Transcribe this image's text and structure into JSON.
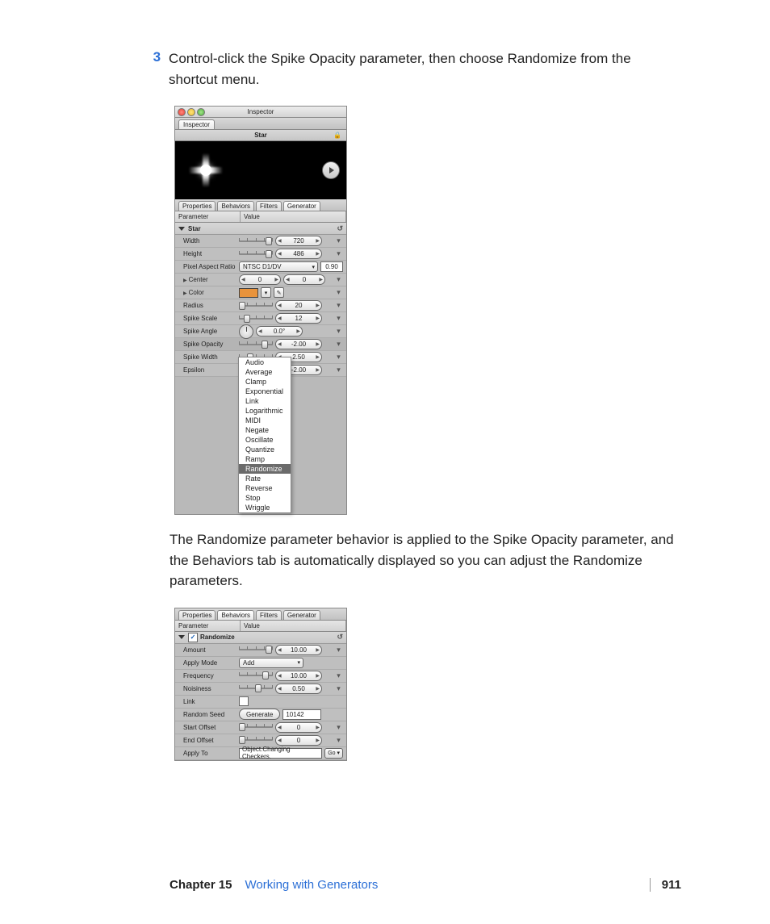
{
  "step": {
    "number": "3",
    "text": "Control-click the Spike Opacity parameter, then choose Randomize from the shortcut menu."
  },
  "paragraph": "The Randomize parameter behavior is applied to the Spike Opacity parameter, and the Behaviors tab is automatically displayed so you can adjust the Randomize parameters.",
  "footer": {
    "chapter": "Chapter 15",
    "title": "Working with Generators",
    "page": "911"
  },
  "panel1": {
    "windowTitle": "Inspector",
    "topTab": "Inspector",
    "objectName": "Star",
    "subtabs": [
      "Properties",
      "Behaviors",
      "Filters",
      "Generator"
    ],
    "activeSubtab": "Generator",
    "columns": {
      "param": "Parameter",
      "value": "Value"
    },
    "groupName": "Star",
    "rows": {
      "width": {
        "label": "Width",
        "value": "720"
      },
      "height": {
        "label": "Height",
        "value": "486"
      },
      "par": {
        "label": "Pixel Aspect Ratio",
        "value": "NTSC D1/DV",
        "ratio": "0.90"
      },
      "center": {
        "label": "Center",
        "x": "0",
        "y": "0"
      },
      "color": {
        "label": "Color"
      },
      "radius": {
        "label": "Radius",
        "value": "20"
      },
      "spikeScale": {
        "label": "Spike Scale",
        "value": "12"
      },
      "spikeAngle": {
        "label": "Spike Angle",
        "value": "0.0°"
      },
      "spikeOpacity": {
        "label": "Spike Opacity",
        "value": "-2.00"
      },
      "spikeWidth": {
        "label": "Spike Width",
        "value": "2.50"
      },
      "epsilon": {
        "label": "Epsilon",
        "value": "-2.00"
      }
    },
    "contextMenu": [
      "Audio",
      "Average",
      "Clamp",
      "Exponential",
      "Link",
      "Logarithmic",
      "MIDI",
      "Negate",
      "Oscillate",
      "Quantize",
      "Ramp",
      "Randomize",
      "Rate",
      "Reverse",
      "Stop",
      "Wriggle"
    ],
    "contextSelected": "Randomize"
  },
  "panel2": {
    "subtabs": [
      "Properties",
      "Behaviors",
      "Filters",
      "Generator"
    ],
    "activeSubtab": "Behaviors",
    "columns": {
      "param": "Parameter",
      "value": "Value"
    },
    "groupName": "Randomize",
    "rows": {
      "amount": {
        "label": "Amount",
        "value": "10.00"
      },
      "applyMode": {
        "label": "Apply Mode",
        "value": "Add"
      },
      "frequency": {
        "label": "Frequency",
        "value": "10.00"
      },
      "noisiness": {
        "label": "Noisiness",
        "value": "0.50"
      },
      "link": {
        "label": "Link"
      },
      "randomSeed": {
        "label": "Random Seed",
        "button": "Generate",
        "value": "10142"
      },
      "startOffset": {
        "label": "Start Offset",
        "value": "0"
      },
      "endOffset": {
        "label": "End Offset",
        "value": "0"
      },
      "applyTo": {
        "label": "Apply To",
        "value": "Object.Changing Checkers.",
        "go": "Go ▾"
      }
    }
  }
}
